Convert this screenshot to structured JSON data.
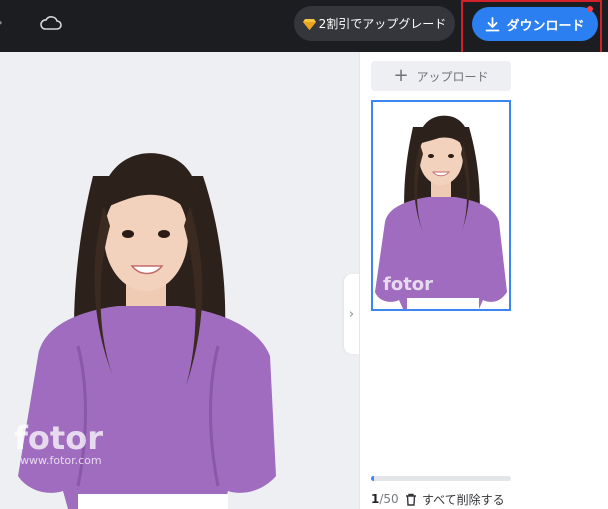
{
  "header": {
    "upgrade_label": "2割引でアップグレード",
    "download_label": "ダウンロード"
  },
  "side_panel": {
    "upload_label": "アップロード",
    "progress": 0.02,
    "count_current": "1",
    "count_total": "/50",
    "delete_all_label": "すべて削除する"
  },
  "watermark": {
    "logo_text": "fotor",
    "url_text": "www.fotor.com"
  },
  "icons": {
    "cloud": "cloud-icon",
    "gem": "gem-icon",
    "download": "download-icon",
    "plus": "plus-icon",
    "trash": "trash-icon",
    "chevron": "chevron-right-icon"
  },
  "colors": {
    "topbar": "#1c1d21",
    "accent": "#2b7ff0",
    "highlight": "#d3212b",
    "canvas": "#eeeff2",
    "blouse": "#9f6cbf"
  }
}
